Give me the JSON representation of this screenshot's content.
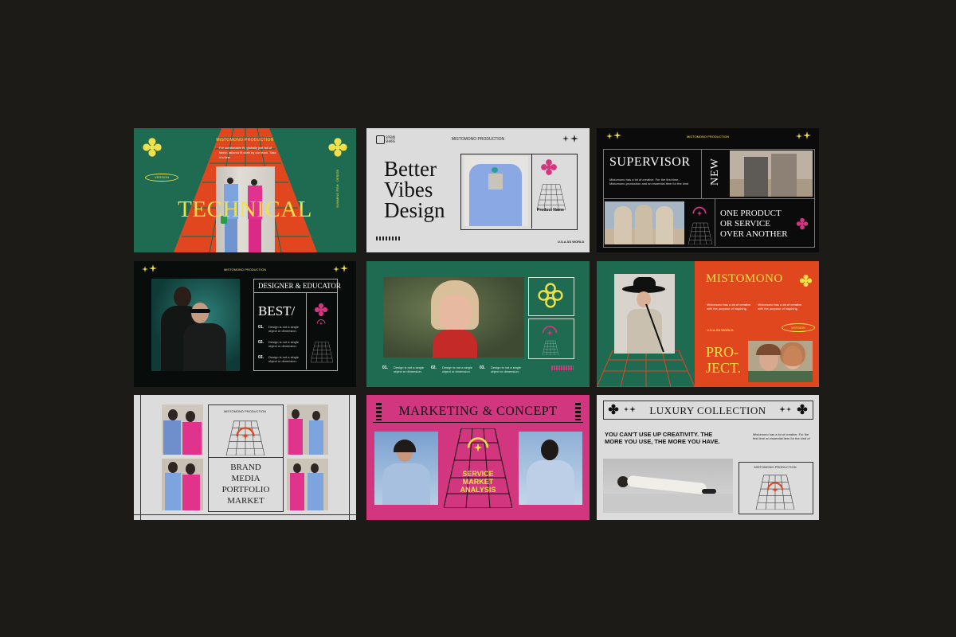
{
  "colors": {
    "background": "#1d1b18",
    "green": "#1f6b52",
    "orange": "#e0471f",
    "pink": "#d2367f",
    "gray": "#dcdcdc",
    "black": "#0b0b0b",
    "yellow": "#f0e04a"
  },
  "s1": {
    "production": "MISTOMONO PRODUCTION",
    "intro": "For comfortable fit, globally just fall of fabric, tailored fit cloth by our team. Take it to line",
    "badge": "VERSION",
    "title": "TECHNICAL",
    "side": "SUMMING FISH · DESIGN"
  },
  "s2": {
    "logo_top": "SPEND",
    "logo_bottom": "SHARE",
    "production": "MISTOMONO PRODUCTION",
    "title_lines": [
      "Better",
      "Vibes",
      "Design"
    ],
    "product": "Product Name",
    "footer": "U.S.A.SS WORLD"
  },
  "s3": {
    "production": "MISTOMONO PRODUCTION",
    "title": "SUPERVISOR",
    "vertical": "NEW",
    "body": "Mistomono has a lot of creative. For the first time, Mistomono production and an essential item for the kind",
    "tagline": [
      "ONE PRODUCT",
      "OR SERVICE",
      "OVER ANOTHER"
    ]
  },
  "s4": {
    "production": "MISTOMONO PRODUCTION",
    "heading": "DESIGNER & EDUCATOR",
    "best": "BEST/",
    "items": [
      {
        "num": "01.",
        "text": "Design is not a single object or dimension."
      },
      {
        "num": "02.",
        "text": "Design is not a single object or dimension."
      },
      {
        "num": "03.",
        "text": "Design is not a single object or dimension."
      }
    ]
  },
  "s5": {
    "items": [
      {
        "num": "01.",
        "text": "Design is not a single object or dimension."
      },
      {
        "num": "02.",
        "text": "Design is not a single object or dimension."
      },
      {
        "num": "03.",
        "text": "Design is not a single object or dimension."
      }
    ]
  },
  "s6": {
    "title": "MISTOMONO",
    "body": "Mistomono has a lot of creative with the purpose of inspiring",
    "world": "U.S.A.SS WORLD.",
    "badge": "VERSION",
    "project": [
      "PRO-",
      "JECT."
    ]
  },
  "s7": {
    "production": "MISTOMONO PRODUCTION",
    "lines": [
      "BRAND",
      "MEDIA",
      "PORTFOLIO",
      "MARKET"
    ]
  },
  "s8": {
    "title": "MARKETING & CONCEPT",
    "lines": [
      "SERVICE",
      "MARKET",
      "ANALYSIS"
    ]
  },
  "s9": {
    "title": "LUXURY COLLECTION",
    "quote": "YOU CAN'T USE UP CREATIVITY. THE MORE YOU USE, THE MORE YOU HAVE.",
    "body": "Mistomono has a lot of creative. For the first time an essential item for the kind of",
    "production": "MISTOMONO PRODUCTION"
  }
}
